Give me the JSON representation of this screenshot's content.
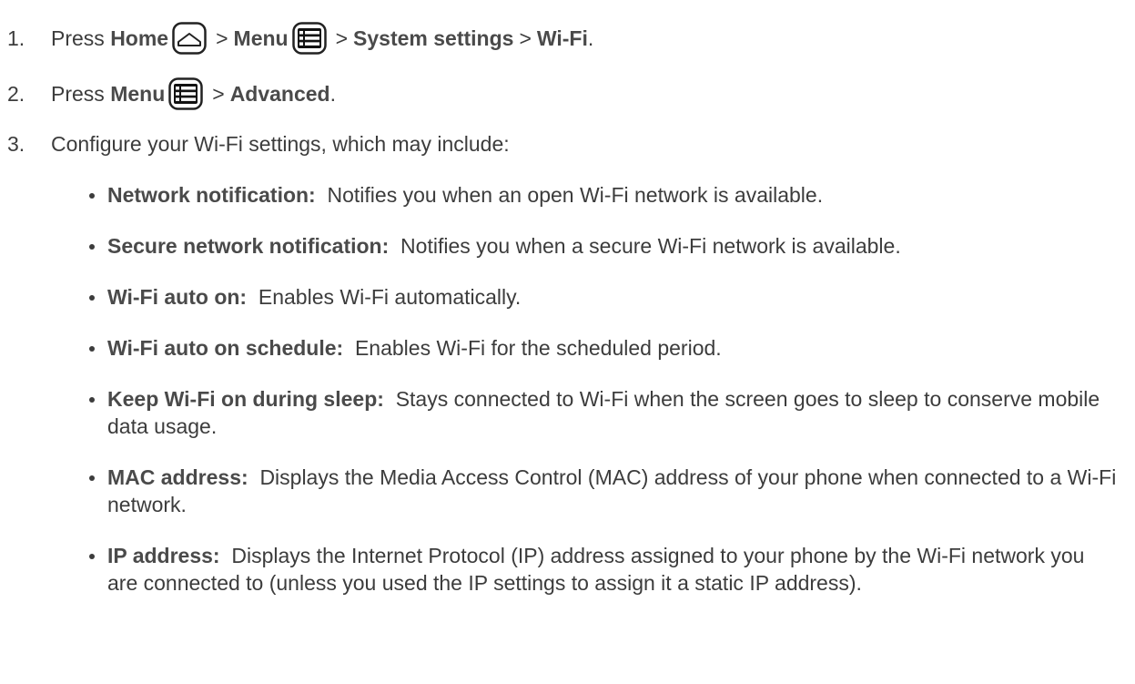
{
  "steps": [
    {
      "num": "1.",
      "parts": {
        "press": "Press",
        "home": "Home",
        "gt1": ">",
        "menu": "Menu",
        "gt2": ">",
        "system_settings": "System settings",
        "gt3": ">",
        "wifi": "Wi-Fi",
        "period": "."
      }
    },
    {
      "num": "2.",
      "parts": {
        "press": "Press",
        "menu": "Menu",
        "gt1": ">",
        "advanced": "Advanced",
        "period": "."
      }
    },
    {
      "num": "3.",
      "text": "Configure your Wi-Fi settings, which may include:"
    }
  ],
  "options": [
    {
      "term": "Network notification:",
      "desc": "Notifies you when an open Wi-Fi network is available."
    },
    {
      "term": "Secure network notification:",
      "desc": "Notifies you when a secure Wi-Fi network is available."
    },
    {
      "term": "Wi-Fi auto on:",
      "desc": "Enables Wi-Fi automatically."
    },
    {
      "term": "Wi-Fi auto on schedule:",
      "desc": "Enables Wi-Fi for the scheduled period."
    },
    {
      "term": "Keep Wi-Fi on during sleep:",
      "desc": "Stays connected to Wi-Fi when the screen goes to sleep to conserve mobile data usage."
    },
    {
      "term": "MAC address:",
      "desc": "Displays the Media Access Control (MAC) address of your phone when connected to a Wi-Fi network."
    },
    {
      "term": "IP address:",
      "desc": "Displays the Internet Protocol (IP) address assigned to your phone by the Wi-Fi network you are connected to (unless you used the IP settings to assign it a static IP address)."
    }
  ],
  "icons": {
    "home": "home-key-icon",
    "menu": "menu-key-icon"
  }
}
